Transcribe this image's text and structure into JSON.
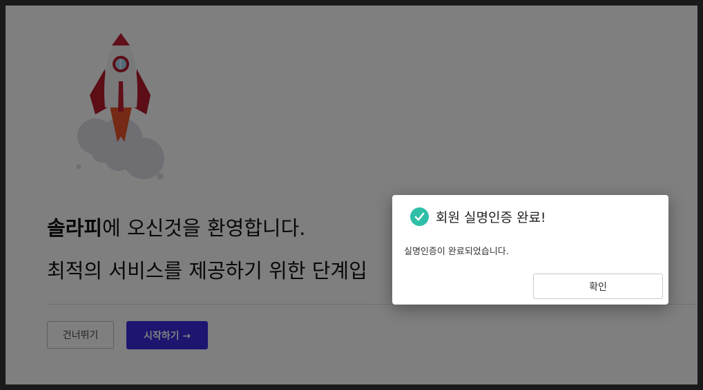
{
  "welcome": {
    "brand": "솔라피",
    "rest": "에 오신것을 환영합니다.",
    "subtitle": "최적의 서비스를 제공하기 위한 단계입"
  },
  "buttons": {
    "skip": "건너뛰기",
    "start": "시작하기 →"
  },
  "modal": {
    "title": "회원 실명인증 완료!",
    "message": "실명인증이 완료되었습니다.",
    "ok": "확인",
    "icon": "check-circle-icon",
    "icon_color": "#2fbfa8"
  },
  "colors": {
    "primary": "#3a2be0",
    "rocket_red": "#c21f32"
  }
}
